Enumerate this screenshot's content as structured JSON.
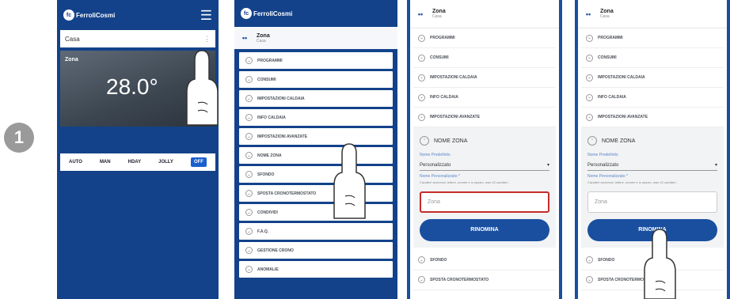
{
  "step": {
    "number": "1"
  },
  "brand": {
    "name": "FerroliCosmi"
  },
  "phone1": {
    "location": "Casa",
    "zone_label": "Zona",
    "zone_sub": "",
    "temperature": "28.0°",
    "modes": [
      "AUTO",
      "MAN",
      "HDAY",
      "JOLLY",
      "OFF"
    ]
  },
  "phone2": {
    "zone_title": "Zona",
    "zone_sub": "Casa",
    "items": [
      "PROGRAMMI",
      "CONSUMI",
      "IMPOSTAZIONI CALDAIA",
      "INFO CALDAIA",
      "IMPOSTAZIONI AVANZATE",
      "NOME ZONA",
      "SFONDO",
      "SPOSTA CRONOTERMOSTATO",
      "CONDIVIDI",
      "F.A.Q.",
      "GESTIONE CRONO",
      "ANOMALIE"
    ]
  },
  "zone_form": {
    "zone_title": "Zona",
    "zone_sub": "Casa",
    "items": [
      "PROGRAMMI",
      "CONSUMI",
      "IMPOSTAZIONI CALDAIA",
      "INFO CALDAIA",
      "IMPOSTAZIONI AVANZATE"
    ],
    "panel_title": "NOME ZONA",
    "predefined_label": "Nome Predefinito",
    "predefined_value": "Personalizzato",
    "custom_label": "Nome Personalizzato *",
    "hint": "Caratteri ammessi: lettere, numeri e lo spazio; max 20 caratteri...",
    "field_value": "Zona",
    "button": "RINOMINA",
    "after_items": [
      "SFONDO",
      "SPOSTA CRONOTERMOSTATO"
    ]
  },
  "colors": {
    "brand_blue": "#13428a",
    "button_blue": "#1a4fa0",
    "highlight": "#c62b2b"
  }
}
